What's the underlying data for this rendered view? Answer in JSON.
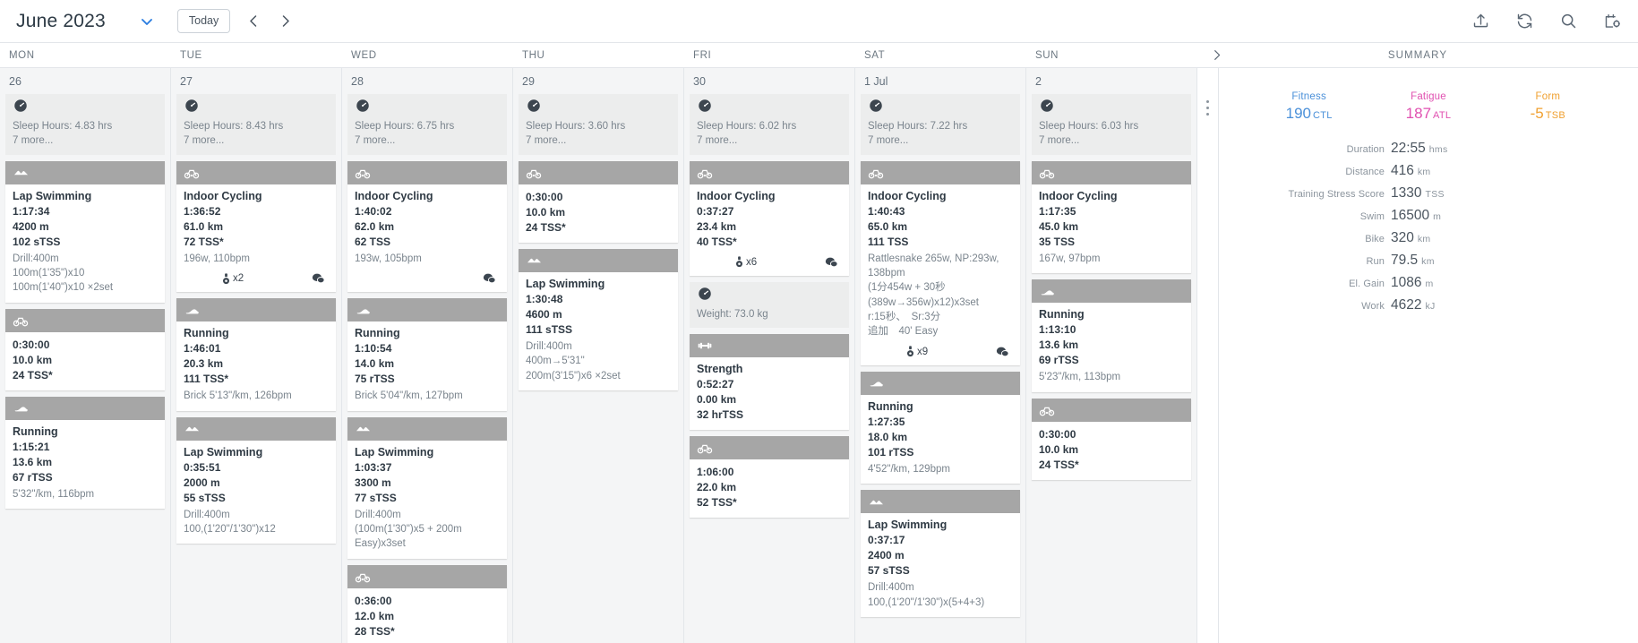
{
  "toolbar": {
    "month_label": "June 2023",
    "today_label": "Today",
    "month_dropdown_icon": "chevron-down-icon",
    "prev_icon": "chevron-left-icon",
    "next_icon": "chevron-right-icon",
    "icons": [
      "upload-icon",
      "sync-icon",
      "search-icon",
      "calendar-settings-icon"
    ]
  },
  "day_headers": [
    "MON",
    "TUE",
    "WED",
    "THU",
    "FRI",
    "SAT",
    "SUN"
  ],
  "summary_header": {
    "label": "SUMMARY",
    "collapse_icon": "chevron-right-icon"
  },
  "days": [
    {
      "daynum": "26",
      "items": [
        {
          "kind": "metric",
          "icon": "gauge-icon",
          "lines": [
            "Sleep Hours: 4.83 hrs",
            "7 more..."
          ]
        },
        {
          "kind": "activity",
          "icon": "swim-icon",
          "title": "Lap Swimming",
          "metrics": [
            "1:17:34",
            "4200 m",
            "102 sTSS"
          ],
          "note": "Drill:400m\n100m(1'35\")x10\n100m(1'40\")x10 ×2set"
        },
        {
          "kind": "activity",
          "icon": "bike-icon",
          "title": "",
          "metrics": [
            "0:30:00",
            "10.0 km",
            "24 TSS*"
          ],
          "note": ""
        },
        {
          "kind": "activity",
          "icon": "run-icon",
          "title": "Running",
          "metrics": [
            "1:15:21",
            "13.6 km",
            "67 rTSS"
          ],
          "note": "5'32\"/km, 116bpm"
        }
      ]
    },
    {
      "daynum": "27",
      "items": [
        {
          "kind": "metric",
          "icon": "gauge-icon",
          "lines": [
            "Sleep Hours: 8.43 hrs",
            "7 more..."
          ]
        },
        {
          "kind": "activity",
          "icon": "bike-icon",
          "title": "Indoor Cycling",
          "metrics": [
            "1:36:52",
            "61.0 km",
            "72 TSS*"
          ],
          "note": "196w, 110bpm",
          "badge_count": "x2",
          "badge_icon": "medal-icon",
          "comment_icon": "comment-icon"
        },
        {
          "kind": "activity",
          "icon": "run-icon",
          "title": "Running",
          "metrics": [
            "1:46:01",
            "20.3 km",
            "111 TSS*"
          ],
          "note": "Brick 5'13\"/km, 126bpm"
        },
        {
          "kind": "activity",
          "icon": "swim-icon",
          "title": "Lap Swimming",
          "metrics": [
            "0:35:51",
            "2000 m",
            "55 sTSS"
          ],
          "note": "Drill:400m\n100,(1'20\"/1'30\")x12"
        }
      ]
    },
    {
      "daynum": "28",
      "items": [
        {
          "kind": "metric",
          "icon": "gauge-icon",
          "lines": [
            "Sleep Hours: 6.75 hrs",
            "7 more..."
          ]
        },
        {
          "kind": "activity",
          "icon": "bike-icon",
          "title": "Indoor Cycling",
          "metrics": [
            "1:40:02",
            "62.0 km",
            "62 TSS"
          ],
          "note": "193w, 105bpm",
          "comment_icon": "comment-icon"
        },
        {
          "kind": "activity",
          "icon": "run-icon",
          "title": "Running",
          "metrics": [
            "1:10:54",
            "14.0 km",
            "75 rTSS"
          ],
          "note": "Brick 5'04\"/km, 127bpm"
        },
        {
          "kind": "activity",
          "icon": "swim-icon",
          "title": "Lap Swimming",
          "metrics": [
            "1:03:37",
            "3300 m",
            "77 sTSS"
          ],
          "note": "Drill:400m\n(100m(1'30\")x5 + 200m Easy)x3set"
        },
        {
          "kind": "activity",
          "icon": "bike-icon",
          "title": "",
          "metrics": [
            "0:36:00",
            "12.0 km",
            "28 TSS*"
          ],
          "note": ""
        }
      ]
    },
    {
      "daynum": "29",
      "items": [
        {
          "kind": "metric",
          "icon": "gauge-icon",
          "lines": [
            "Sleep Hours: 3.60 hrs",
            "7 more..."
          ]
        },
        {
          "kind": "activity",
          "icon": "bike-icon",
          "title": "",
          "metrics": [
            "0:30:00",
            "10.0 km",
            "24 TSS*"
          ],
          "note": ""
        },
        {
          "kind": "activity",
          "icon": "swim-icon",
          "title": "Lap Swimming",
          "metrics": [
            "1:30:48",
            "4600 m",
            "111 sTSS"
          ],
          "note": "Drill:400m\n400m→5'31\"\n200m(3'15\")x6 ×2set"
        }
      ]
    },
    {
      "daynum": "30",
      "items": [
        {
          "kind": "metric",
          "icon": "gauge-icon",
          "lines": [
            "Sleep Hours: 6.02 hrs",
            "7 more..."
          ]
        },
        {
          "kind": "activity",
          "icon": "bike-icon",
          "title": "Indoor Cycling",
          "metrics": [
            "0:37:27",
            "23.4 km",
            "40 TSS*"
          ],
          "note": "",
          "badge_count": "x6",
          "badge_icon": "medal-icon",
          "comment_icon": "comment-icon"
        },
        {
          "kind": "metric",
          "icon": "gauge-icon",
          "lines": [
            "Weight: 73.0 kg"
          ]
        },
        {
          "kind": "activity",
          "icon": "strength-icon",
          "title": "Strength",
          "metrics": [
            "0:52:27",
            "0.00 km",
            "32 hrTSS"
          ],
          "note": ""
        },
        {
          "kind": "activity",
          "icon": "bike-icon",
          "title": "",
          "metrics": [
            "1:06:00",
            "22.0 km",
            "52 TSS*"
          ],
          "note": ""
        }
      ]
    },
    {
      "daynum": "1 Jul",
      "items": [
        {
          "kind": "metric",
          "icon": "gauge-icon",
          "lines": [
            "Sleep Hours: 7.22 hrs",
            "7 more..."
          ]
        },
        {
          "kind": "activity",
          "icon": "bike-icon",
          "title": "Indoor Cycling",
          "metrics": [
            "1:40:43",
            "65.0 km",
            "111 TSS"
          ],
          "note": "Rattlesnake 265w, NP:293w, 138bpm\n(1分454w + 30秒\n(389w→356w)x12)x3set\nr:15秒、　Sr:3分\n追加　40' Easy",
          "badge_count": "x9",
          "badge_icon": "medal-icon",
          "comment_icon": "comment-icon"
        },
        {
          "kind": "activity",
          "icon": "run-icon",
          "title": "Running",
          "metrics": [
            "1:27:35",
            "18.0 km",
            "101 rTSS"
          ],
          "note": "4'52\"/km, 129bpm"
        },
        {
          "kind": "activity",
          "icon": "swim-icon",
          "title": "Lap Swimming",
          "metrics": [
            "0:37:17",
            "2400 m",
            "57 sTSS"
          ],
          "note": "Drill:400m\n100,(1'20\"/1'30\")x(5+4+3)"
        }
      ]
    },
    {
      "daynum": "2",
      "items": [
        {
          "kind": "metric",
          "icon": "gauge-icon",
          "lines": [
            "Sleep Hours: 6.03 hrs",
            "7 more..."
          ]
        },
        {
          "kind": "activity",
          "icon": "bike-icon",
          "title": "Indoor Cycling",
          "metrics": [
            "1:17:35",
            "45.0 km",
            "35 TSS"
          ],
          "note": "167w, 97bpm"
        },
        {
          "kind": "activity",
          "icon": "run-icon",
          "title": "Running",
          "metrics": [
            "1:13:10",
            "13.6 km",
            "69 rTSS"
          ],
          "note": "5'23\"/km, 113bpm"
        },
        {
          "kind": "activity",
          "icon": "bike-icon",
          "title": "",
          "metrics": [
            "0:30:00",
            "10.0 km",
            "24 TSS*"
          ],
          "note": ""
        }
      ]
    }
  ],
  "summary": {
    "pmc": [
      {
        "label": "Fitness",
        "value": "190",
        "unit": "CTL",
        "color": "#4a90d9"
      },
      {
        "label": "Fatigue",
        "value": "187",
        "unit": "ATL",
        "color": "#e050b0"
      },
      {
        "label": "Form",
        "value": "-5",
        "unit": "TSB",
        "color": "#f0a030"
      }
    ],
    "totals": [
      {
        "label": "Duration",
        "value": "22:55",
        "unit": "hms"
      },
      {
        "label": "Distance",
        "value": "416",
        "unit": "km"
      },
      {
        "label": "Training Stress Score",
        "value": "1330",
        "unit": "TSS"
      },
      {
        "label": "Swim",
        "value": "16500",
        "unit": "m"
      },
      {
        "label": "Bike",
        "value": "320",
        "unit": "km"
      },
      {
        "label": "Run",
        "value": "79.5",
        "unit": "km"
      },
      {
        "label": "El. Gain",
        "value": "1086",
        "unit": "m"
      },
      {
        "label": "Work",
        "value": "4622",
        "unit": "kJ"
      }
    ]
  }
}
